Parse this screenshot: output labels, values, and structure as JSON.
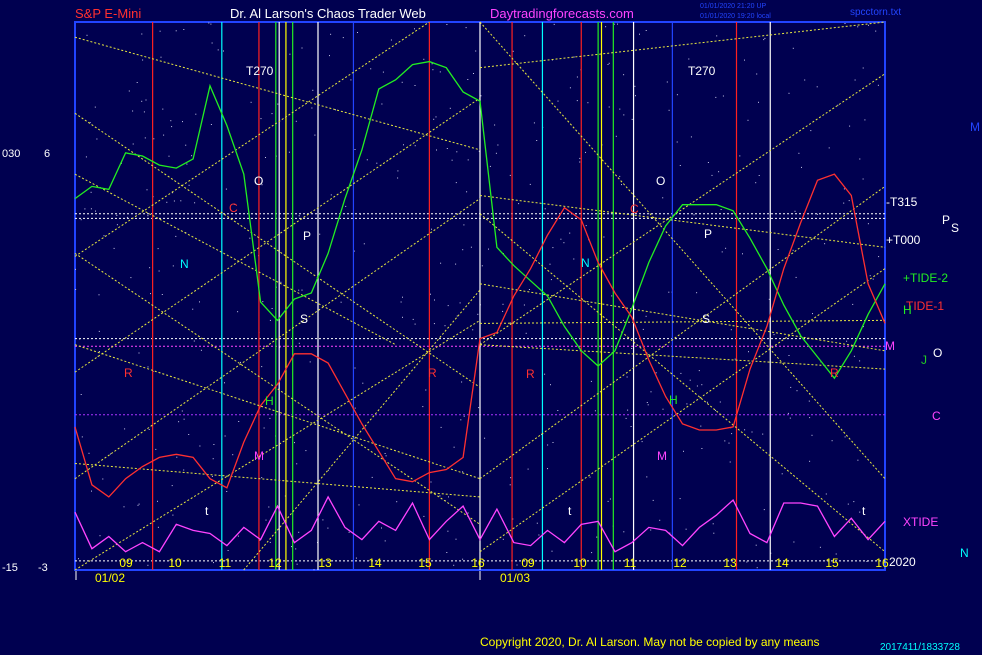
{
  "header": {
    "symbol": "S&P E-Mini",
    "author": "Dr. Al Larson's Chaos Trader Web",
    "site": "Daytradingforecasts.com",
    "stamp1": "01/01/2020 21:20 UP",
    "stamp2": "01/01/2020 19:20 local",
    "file": "spcctorn.txt"
  },
  "footer": {
    "copyright": "Copyright 2020, Dr. Al Larson. May not be copied by any means",
    "code": "2017411/1833728"
  },
  "left_labels": {
    "top_a": "030",
    "top_b": "6",
    "bottom_a": "-15",
    "bottom_b": "-3"
  },
  "right_labels": [
    {
      "text": "-T315",
      "color": "#ffffff"
    },
    {
      "text": "+T000",
      "color": "#ffffff"
    },
    {
      "text": "+TIDE-2",
      "color": "#22ee22"
    },
    {
      "text": "TIDE-1",
      "color": "#ff3030"
    },
    {
      "text": "XTIDE",
      "color": "#ff44ff"
    },
    {
      "text": "2020",
      "color": "#ffffff"
    }
  ],
  "planet_glyphs": [
    {
      "text": "M",
      "color": "#2244ff"
    },
    {
      "text": "P",
      "color": "#ffffff"
    },
    {
      "text": "S",
      "color": "#ffffff"
    },
    {
      "text": "H",
      "color": "#22ee22"
    },
    {
      "text": "M",
      "color": "#ff44ff"
    },
    {
      "text": "J",
      "color": "#22cc22"
    },
    {
      "text": "O",
      "color": "#ffffff"
    },
    {
      "text": "C",
      "color": "#ff44ff"
    },
    {
      "text": "N",
      "color": "#00ffff"
    }
  ],
  "vline_labels": [
    {
      "text": "T270",
      "color": "#ffffff"
    },
    {
      "text": "T270",
      "color": "#ffffff"
    },
    {
      "text": "O",
      "color": "#ffffff"
    },
    {
      "text": "O",
      "color": "#ffffff"
    },
    {
      "text": "C",
      "color": "#ff3030"
    },
    {
      "text": "C",
      "color": "#ff3030"
    },
    {
      "text": "P",
      "color": "#ffffff"
    },
    {
      "text": "P",
      "color": "#ffffff"
    },
    {
      "text": "N",
      "color": "#00ffff"
    },
    {
      "text": "N",
      "color": "#00ffff"
    },
    {
      "text": "S",
      "color": "#ffffff"
    },
    {
      "text": "S",
      "color": "#ffffff"
    },
    {
      "text": "H",
      "color": "#22ee22"
    },
    {
      "text": "H",
      "color": "#22ee22"
    },
    {
      "text": "M",
      "color": "#ff44ff"
    },
    {
      "text": "M",
      "color": "#ff44ff"
    },
    {
      "text": "R",
      "color": "#ff3030"
    },
    {
      "text": "R",
      "color": "#ff3030"
    },
    {
      "text": "R",
      "color": "#ff3030"
    },
    {
      "text": "R",
      "color": "#ff3030"
    },
    {
      "text": "t",
      "color": "#ffffff"
    },
    {
      "text": "t",
      "color": "#ffffff"
    },
    {
      "text": "t",
      "color": "#ffffff"
    }
  ],
  "chart_data": {
    "type": "line",
    "x_ticks": [
      "09",
      "10",
      "11",
      "12",
      "13",
      "14",
      "15",
      "16",
      "09",
      "10",
      "11",
      "12",
      "13",
      "14",
      "15",
      "16"
    ],
    "date_labels": [
      "01/02",
      "01/03"
    ],
    "series": [
      {
        "name": "+TIDE-2",
        "color": "#22ee22",
        "values": [
          3.2,
          3.6,
          3.5,
          4.7,
          4.6,
          4.3,
          4.2,
          4.5,
          6.9,
          5.6,
          4.0,
          -0.2,
          -0.8,
          -0.1,
          0.1,
          1.4,
          3.2,
          4.8,
          6.8,
          7.1,
          7.6,
          7.7,
          7.5,
          6.7,
          6.4,
          1.6,
          1.0,
          0.5,
          0.0,
          -1.0,
          -1.8,
          -2.3,
          -1.8,
          -0.4,
          1.1,
          2.3,
          3.0,
          3.0,
          3.0,
          2.8,
          1.9,
          0.9,
          -0.3,
          -1.3,
          -2.0,
          -2.7,
          -1.8,
          -0.6,
          0.4
        ]
      },
      {
        "name": "TIDE-1",
        "color": "#ff3030",
        "values": [
          -4.3,
          -6.2,
          -6.6,
          -6.0,
          -5.6,
          -5.3,
          -5.2,
          -5.3,
          -6.0,
          -6.3,
          -4.8,
          -3.6,
          -2.9,
          -1.9,
          -1.9,
          -2.2,
          -3.2,
          -4.2,
          -5.1,
          -6.0,
          -6.1,
          -5.8,
          -5.7,
          -5.3,
          -1.4,
          -1.2,
          0.0,
          0.9,
          2.0,
          2.9,
          2.5,
          1.1,
          0.1,
          -0.7,
          -2.1,
          -3.3,
          -4.2,
          -4.4,
          -4.4,
          -4.3,
          -2.4,
          -1.0,
          0.9,
          2.4,
          3.8,
          4.0,
          3.3,
          0.4,
          -0.9
        ]
      },
      {
        "name": "XTIDE",
        "color": "#ff44ff",
        "values": [
          -7.1,
          -8.3,
          -7.9,
          -8.4,
          -8.1,
          -8.4,
          -7.5,
          -7.7,
          -7.8,
          -8.2,
          -7.6,
          -8.0,
          -6.9,
          -8.1,
          -7.7,
          -6.6,
          -7.6,
          -8.0,
          -7.4,
          -7.7,
          -6.8,
          -8.0,
          -7.4,
          -6.9,
          -8.0,
          -7.0,
          -8.1,
          -8.2,
          -7.7,
          -8.1,
          -7.5,
          -7.4,
          -8.4,
          -8.1,
          -7.6,
          -7.7,
          -8.2,
          -7.6,
          -7.2,
          -6.7,
          -7.8,
          -8.1,
          -6.8,
          -6.8,
          -6.9,
          -7.9,
          -7.3,
          -8.0,
          -7.4
        ]
      }
    ],
    "ylim": [
      -9.0,
      9.0
    ],
    "vlines": [
      {
        "x": 2.3,
        "color": "#ff2020"
      },
      {
        "x": 4.35,
        "color": "#00ffff"
      },
      {
        "x": 5.45,
        "color": "#ff2020"
      },
      {
        "x": 5.95,
        "color": "#22ee22"
      },
      {
        "x": 6.05,
        "color": "#ffffff"
      },
      {
        "x": 6.25,
        "color": "#ffff00"
      },
      {
        "x": 6.45,
        "color": "#22ee22"
      },
      {
        "x": 7.2,
        "color": "#ffffff"
      },
      {
        "x": 8.25,
        "color": "#2244ff"
      },
      {
        "x": 10.5,
        "color": "#ff2020"
      },
      {
        "x": 12.0,
        "color": "#ffffff"
      },
      {
        "x": 12.95,
        "color": "#ff2020"
      },
      {
        "x": 13.85,
        "color": "#00ffff"
      },
      {
        "x": 15.0,
        "color": "#ff2020"
      },
      {
        "x": 15.5,
        "color": "#22ee22"
      },
      {
        "x": 15.6,
        "color": "#ffff00"
      },
      {
        "x": 15.95,
        "color": "#22ee22"
      },
      {
        "x": 16.55,
        "color": "#ffffff"
      },
      {
        "x": 17.7,
        "color": "#2244ff"
      },
      {
        "x": 19.6,
        "color": "#ff2020"
      },
      {
        "x": 20.6,
        "color": "#ffffff"
      }
    ],
    "hlines": [
      {
        "y": 2.7,
        "color": "#ffffff"
      },
      {
        "y": 2.55,
        "color": "#ffffff"
      },
      {
        "y": -1.4,
        "color": "#ffffff"
      },
      {
        "y": -1.65,
        "color": "#ff44ff"
      },
      {
        "y": -3.9,
        "color": "#aa33ff"
      },
      {
        "y": -8.7,
        "color": "#ffffff"
      }
    ],
    "diagonals": [
      {
        "x1": 0,
        "y1": 8.5,
        "x2": 12.0,
        "y2": 4.8
      },
      {
        "x1": 0,
        "y1": 6.0,
        "x2": 12.0,
        "y2": -3.0
      },
      {
        "x1": 0,
        "y1": 4.0,
        "x2": 9.5,
        "y2": -1.6
      },
      {
        "x1": 0,
        "y1": 1.4,
        "x2": 12.0,
        "y2": -7.5
      },
      {
        "x1": 0,
        "y1": -1.6,
        "x2": 12.0,
        "y2": -6.0
      },
      {
        "x1": 0,
        "y1": -5.5,
        "x2": 12.0,
        "y2": -6.6
      },
      {
        "x1": 0,
        "y1": -9.0,
        "x2": 12.0,
        "y2": -0.8
      },
      {
        "x1": 0,
        "y1": -6.0,
        "x2": 12.0,
        "y2": 3.2
      },
      {
        "x1": 0,
        "y1": -2.5,
        "x2": 12.0,
        "y2": 6.5
      },
      {
        "x1": 0,
        "y1": 1.3,
        "x2": 10.5,
        "y2": 9.0
      },
      {
        "x1": 5.0,
        "y1": -9.0,
        "x2": 12.0,
        "y2": 0.2
      },
      {
        "x1": 12.0,
        "y1": -1.6,
        "x2": 24.0,
        "y2": -2.4
      },
      {
        "x1": 12.0,
        "y1": 3.3,
        "x2": 24.0,
        "y2": 1.6
      },
      {
        "x1": 12.0,
        "y1": 9.0,
        "x2": 24.0,
        "y2": -6.0
      },
      {
        "x1": 12.0,
        "y1": 7.5,
        "x2": 24.0,
        "y2": 9.0
      },
      {
        "x1": 12.0,
        "y1": 2.7,
        "x2": 24.0,
        "y2": -8.4
      },
      {
        "x1": 12.0,
        "y1": -6.0,
        "x2": 24.0,
        "y2": 3.6
      },
      {
        "x1": 12.0,
        "y1": -1.6,
        "x2": 24.0,
        "y2": 7.3
      },
      {
        "x1": 12.0,
        "y1": -8.4,
        "x2": 24.0,
        "y2": 0.9
      },
      {
        "x1": 12.0,
        "y1": 0.4,
        "x2": 24.0,
        "y2": -1.8
      },
      {
        "x1": 12.0,
        "y1": -0.9,
        "x2": 24.0,
        "y2": -0.8
      }
    ],
    "xlim": [
      0,
      24
    ]
  }
}
